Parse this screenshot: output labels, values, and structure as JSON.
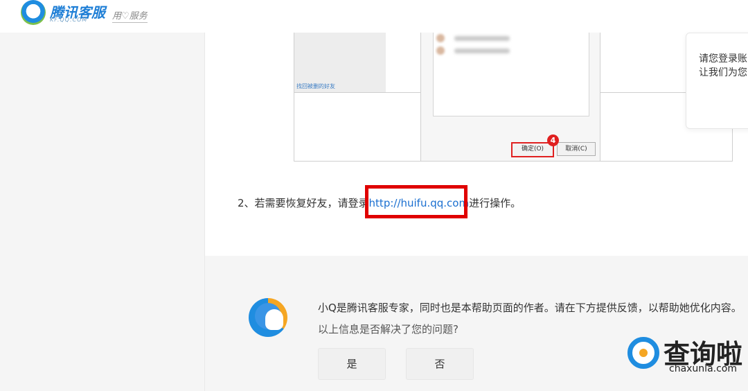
{
  "header": {
    "logo_name": "腾讯客服",
    "logo_sub": "KF.QQ.COM",
    "slogan": "用♡服务"
  },
  "figure": {
    "left_link": "找回被删的好友",
    "ok_button": "确定(O)",
    "cancel_button": "取消(C)",
    "badge": "4"
  },
  "step": {
    "prefix": "2、若需要恢复好友，请登录",
    "link": "http://huifu.qq.com",
    "suffix": "进行操作。"
  },
  "popup": {
    "line1": "请您登录账",
    "line2": "让我们为您"
  },
  "feedback": {
    "intro": "小Q是腾讯客服专家，同时也是本帮助页面的作者。请在下方提供反馈，以帮助她优化内容。",
    "question": "以上信息是否解决了您的问题?",
    "yes_label": "是",
    "no_label": "否"
  },
  "watermark": {
    "main": "查询啦",
    "sub": "chaxunla.com"
  },
  "colors": {
    "link": "#1a6fd0",
    "highlight": "#e00000",
    "brand_blue": "#1f8de0",
    "brand_orange": "#f5a623"
  }
}
